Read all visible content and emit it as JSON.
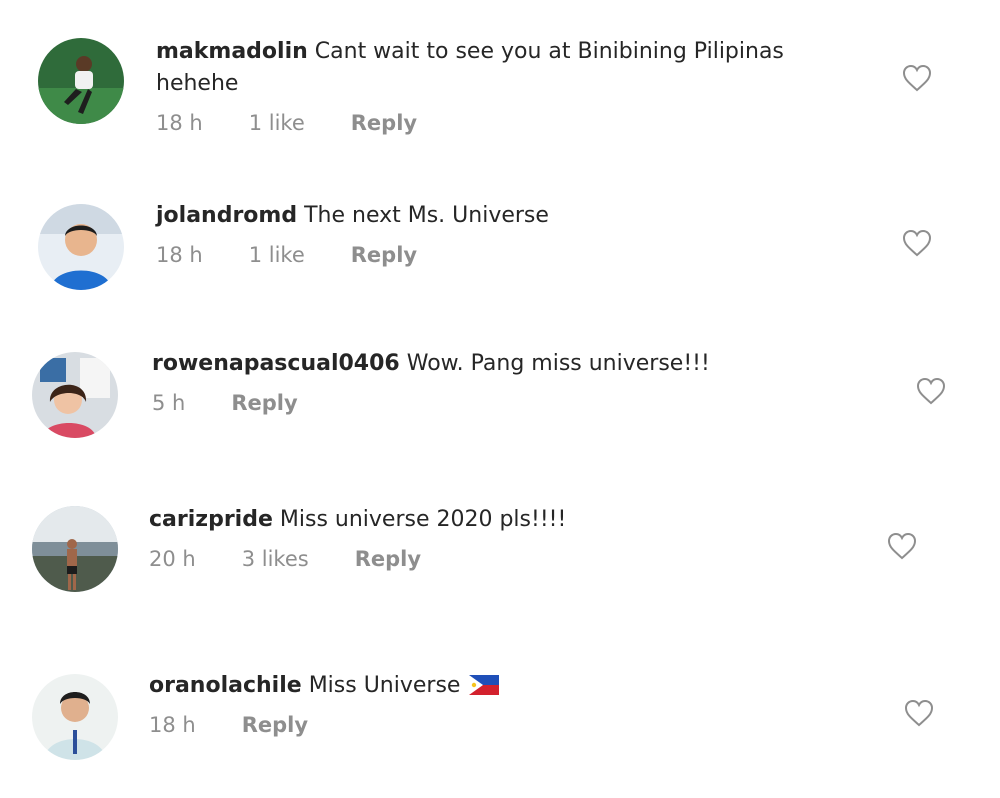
{
  "comments": [
    {
      "username": "makmadolin",
      "text": "Cant wait to see you at Binibining Pilipinas hehehe",
      "time": "18 h",
      "likes": "1 like",
      "reply": "Reply"
    },
    {
      "username": "jolandromd",
      "text": "The next Ms. Universe",
      "time": "18 h",
      "likes": "1 like",
      "reply": "Reply"
    },
    {
      "username": "rowenapascual0406",
      "text": "Wow. Pang miss universe!!!",
      "time": "5 h",
      "reply": "Reply"
    },
    {
      "username": "carizpride",
      "text": "Miss universe 2020 pls!!!!",
      "time": "20 h",
      "likes": "3 likes",
      "reply": "Reply"
    },
    {
      "username": "oranolachile",
      "text": "Miss Universe",
      "emoji": "philippines-flag-icon",
      "time": "18 h",
      "reply": "Reply"
    }
  ],
  "icons": {
    "like": "heart-outline-icon"
  },
  "colors": {
    "text": "#262626",
    "meta": "#8e8e8e",
    "background": "#ffffff"
  }
}
